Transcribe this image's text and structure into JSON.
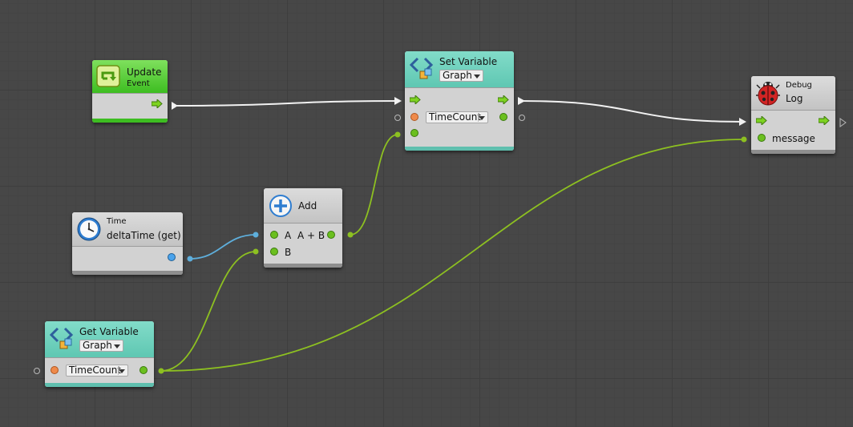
{
  "nodes": {
    "update": {
      "title": "Update",
      "subtitle": "Event",
      "icon": "loop-icon"
    },
    "set_variable": {
      "title": "Set Variable",
      "scope": "Graph",
      "variable": "TimeCount",
      "icon": "variable-icon"
    },
    "debug_log": {
      "category": "Debug",
      "title": "Log",
      "input_label": "message",
      "icon": "ladybug-icon"
    },
    "time": {
      "category": "Time",
      "title": "deltaTime (get)",
      "icon": "clock-icon"
    },
    "add": {
      "title": "Add",
      "input_a": "A",
      "input_b": "B",
      "output": "A + B",
      "icon": "plus-icon"
    },
    "get_variable": {
      "title": "Get Variable",
      "scope": "Graph",
      "variable": "TimeCount",
      "icon": "variable-icon"
    }
  },
  "colors": {
    "canvas": "#474747",
    "flow_wire": "#f2f2f2",
    "value_wire": "#8dc021",
    "float_wire": "#5eaedb",
    "header_event": "#3dbd21",
    "header_variable": "#6fd2bd",
    "node_body": "#d2d2d2"
  }
}
